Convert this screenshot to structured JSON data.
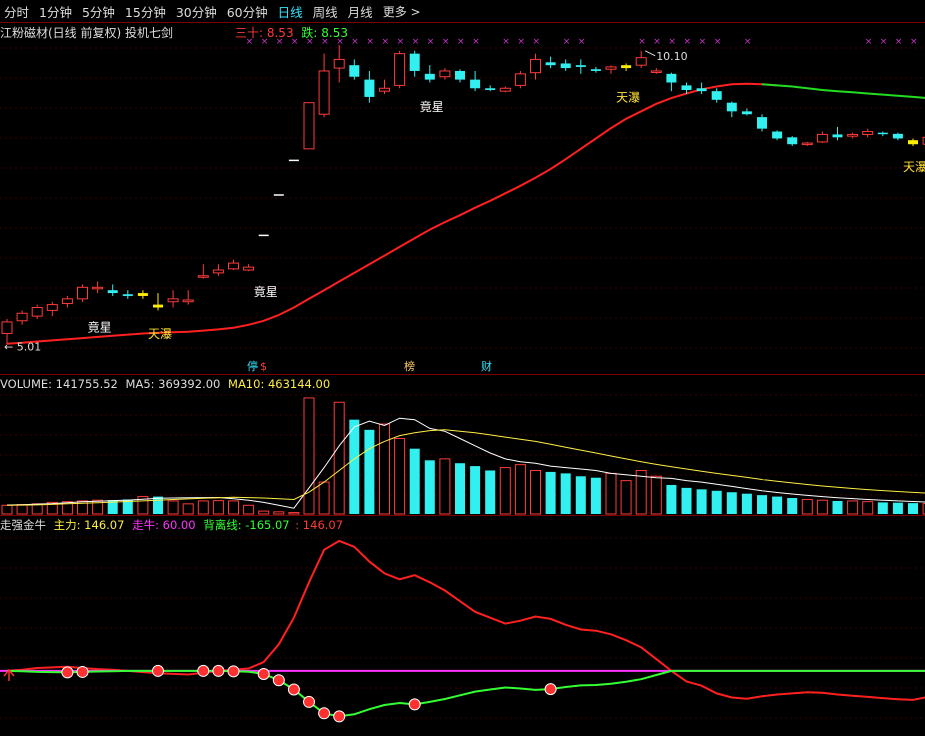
{
  "toolbar": {
    "tabs": [
      {
        "label": "分时",
        "active": false
      },
      {
        "label": "1分钟",
        "active": false
      },
      {
        "label": "5分钟",
        "active": false
      },
      {
        "label": "15分钟",
        "active": false
      },
      {
        "label": "30分钟",
        "active": false
      },
      {
        "label": "60分钟",
        "active": false
      },
      {
        "label": "日线",
        "active": true
      },
      {
        "label": "周线",
        "active": false
      },
      {
        "label": "月线",
        "active": false
      }
    ],
    "more_label": "更多 >"
  },
  "chart_header": {
    "title": "江粉磁材(日线 前复权) 投机七剑",
    "legend_sanshi_label": "三十: 8.53",
    "legend_die_label": "跌: 8.53",
    "legend_sanshi_color": "#ff3b3b",
    "legend_die_color": "#33ff33"
  },
  "price_panel": {
    "high_label": "10.10",
    "low_label": "5.01",
    "annotations": [
      {
        "text": "竟星",
        "color": "#ffffff"
      },
      {
        "text": "天瀑",
        "color": "#ffe033"
      },
      {
        "text": "竟星",
        "color": "#ffffff"
      },
      {
        "text": "竟星",
        "color": "#ffffff"
      },
      {
        "text": "天瀑",
        "color": "#ffe033"
      },
      {
        "text": "天瀑",
        "color": "#ffe033"
      }
    ],
    "event_markers": [
      {
        "text": "停",
        "color": "#33e6ff"
      },
      {
        "text": "$",
        "color": "#ff3b3b"
      },
      {
        "text": "榜",
        "color": "#ffcc66"
      },
      {
        "text": "财",
        "color": "#33e6ff"
      }
    ],
    "candle_up_color": "#ff3b3b",
    "candle_down_color": "#33f0f0",
    "signal_color": "#ffee00",
    "ma_color_up": "#ff2020",
    "ma_color_down": "#22dd22"
  },
  "volume_panel": {
    "volume_label": "VOLUME: 141755.52",
    "ma5_label": "MA5: 369392.00",
    "ma10_label": "MA10: 463144.00",
    "ma5_color": "#ffffff",
    "ma10_color": "#ffee44"
  },
  "indicator_panel": {
    "name_label": "走强金牛",
    "zhuli_label": "主力: 146.07",
    "zouniu_label": "走牛: 60.00",
    "beili_label": "背离线: -165.07",
    "extra_label": ": 146.07",
    "zhuli_color": "#ffee44",
    "zouniu_color": "#ff33ff",
    "beili_color": "#33ff33",
    "extra_color": "#ff3b3b"
  },
  "chart_data": {
    "type": "candlestick",
    "candles": [
      [
        5.2,
        5.45,
        5.01,
        5.4
      ],
      [
        5.42,
        5.6,
        5.35,
        5.55
      ],
      [
        5.5,
        5.7,
        5.45,
        5.65
      ],
      [
        5.6,
        5.75,
        5.5,
        5.7
      ],
      [
        5.72,
        5.85,
        5.65,
        5.8
      ],
      [
        5.8,
        6.05,
        5.75,
        6.0
      ],
      [
        6.0,
        6.1,
        5.9,
        6.0
      ],
      [
        5.95,
        6.05,
        5.85,
        5.9
      ],
      [
        5.88,
        5.95,
        5.8,
        5.85
      ],
      [
        5.85,
        5.95,
        5.8,
        5.9
      ],
      [
        5.7,
        5.9,
        5.6,
        5.65
      ],
      [
        5.75,
        5.95,
        5.65,
        5.8
      ],
      [
        5.75,
        5.95,
        5.7,
        5.78
      ],
      [
        6.2,
        6.4,
        6.15,
        6.2
      ],
      [
        6.25,
        6.4,
        6.2,
        6.3
      ],
      [
        6.32,
        6.48,
        6.3,
        6.42
      ],
      [
        6.3,
        6.4,
        6.28,
        6.35
      ],
      [
        6.9,
        6.9,
        6.9,
        6.9
      ],
      [
        7.6,
        7.6,
        7.6,
        7.6
      ],
      [
        8.2,
        8.2,
        8.2,
        8.2
      ],
      [
        8.4,
        9.2,
        8.4,
        9.2
      ],
      [
        9.0,
        10.05,
        8.95,
        9.75
      ],
      [
        9.8,
        10.2,
        9.55,
        9.95
      ],
      [
        9.85,
        9.95,
        9.6,
        9.65
      ],
      [
        9.6,
        9.75,
        9.2,
        9.3
      ],
      [
        9.4,
        9.6,
        9.35,
        9.45
      ],
      [
        9.5,
        10.1,
        9.45,
        10.05
      ],
      [
        10.05,
        10.1,
        9.65,
        9.75
      ],
      [
        9.7,
        9.85,
        9.55,
        9.6
      ],
      [
        9.65,
        9.8,
        9.6,
        9.75
      ],
      [
        9.75,
        9.78,
        9.55,
        9.6
      ],
      [
        9.6,
        9.75,
        9.4,
        9.45
      ],
      [
        9.45,
        9.5,
        9.4,
        9.42
      ],
      [
        9.4,
        9.48,
        9.38,
        9.45
      ],
      [
        9.5,
        9.75,
        9.45,
        9.7
      ],
      [
        9.72,
        10.05,
        9.6,
        9.95
      ],
      [
        9.9,
        10.0,
        9.8,
        9.85
      ],
      [
        9.88,
        9.95,
        9.75,
        9.8
      ],
      [
        9.85,
        9.95,
        9.7,
        9.82
      ],
      [
        9.78,
        9.82,
        9.72,
        9.75
      ],
      [
        9.78,
        9.85,
        9.7,
        9.82
      ],
      [
        9.8,
        9.88,
        9.75,
        9.85
      ],
      [
        9.85,
        10.1,
        9.8,
        9.98
      ],
      [
        9.75,
        9.8,
        9.7,
        9.75
      ],
      [
        9.7,
        9.72,
        9.4,
        9.55
      ],
      [
        9.5,
        9.55,
        9.35,
        9.42
      ],
      [
        9.45,
        9.55,
        9.35,
        9.4
      ],
      [
        9.4,
        9.45,
        9.2,
        9.25
      ],
      [
        9.2,
        9.22,
        8.95,
        9.05
      ],
      [
        9.05,
        9.1,
        8.98,
        9.0
      ],
      [
        8.95,
        9.0,
        8.7,
        8.75
      ],
      [
        8.7,
        8.72,
        8.55,
        8.58
      ],
      [
        8.6,
        8.62,
        8.45,
        8.48
      ],
      [
        8.5,
        8.52,
        8.45,
        8.5
      ],
      [
        8.52,
        8.7,
        8.5,
        8.65
      ],
      [
        8.65,
        8.78,
        8.55,
        8.6
      ],
      [
        8.62,
        8.68,
        8.58,
        8.65
      ],
      [
        8.65,
        8.75,
        8.6,
        8.7
      ],
      [
        8.68,
        8.7,
        8.62,
        8.66
      ],
      [
        8.66,
        8.68,
        8.55,
        8.58
      ],
      [
        8.55,
        8.58,
        8.45,
        8.48
      ],
      [
        8.48,
        8.7,
        8.45,
        8.6
      ]
    ],
    "ma": [
      5.02,
      5.04,
      5.06,
      5.08,
      5.1,
      5.12,
      5.14,
      5.16,
      5.18,
      5.2,
      5.21,
      5.22,
      5.23,
      5.25,
      5.27,
      5.3,
      5.35,
      5.42,
      5.52,
      5.65,
      5.8,
      5.95,
      6.1,
      6.25,
      6.4,
      6.55,
      6.7,
      6.85,
      7.0,
      7.13,
      7.25,
      7.38,
      7.5,
      7.63,
      7.76,
      7.9,
      8.05,
      8.22,
      8.4,
      8.58,
      8.76,
      8.92,
      9.05,
      9.18,
      9.28,
      9.36,
      9.43,
      9.48,
      9.52,
      9.53,
      9.52,
      9.5,
      9.48,
      9.45,
      9.42,
      9.4,
      9.38,
      9.36,
      9.34,
      9.32,
      9.3,
      9.28
    ],
    "volume": [
      60,
      65,
      70,
      80,
      85,
      90,
      95,
      95,
      100,
      120,
      120,
      90,
      70,
      90,
      92,
      90,
      60,
      20,
      15,
      10,
      800,
      220,
      770,
      650,
      580,
      620,
      520,
      450,
      370,
      380,
      350,
      330,
      300,
      320,
      340,
      300,
      290,
      280,
      260,
      250,
      280,
      230,
      300,
      260,
      200,
      180,
      170,
      160,
      150,
      140,
      130,
      120,
      110,
      100,
      95,
      90,
      90,
      85,
      80,
      78,
      75,
      72
    ],
    "vol_ma5": [
      62,
      64,
      68,
      72,
      78,
      84,
      88,
      92,
      96,
      102,
      108,
      110,
      112,
      113,
      114,
      105,
      95,
      80,
      60,
      40,
      180,
      320,
      470,
      600,
      640,
      610,
      660,
      650,
      590,
      570,
      520,
      470,
      420,
      380,
      360,
      350,
      330,
      320,
      310,
      300,
      280,
      270,
      260,
      250,
      245,
      230,
      220,
      205,
      190,
      175,
      160,
      148,
      138,
      128,
      120,
      112,
      106,
      100,
      95,
      90,
      86,
      82
    ],
    "vol_ma10": [
      60,
      61,
      63,
      66,
      70,
      74,
      78,
      82,
      86,
      90,
      95,
      100,
      104,
      108,
      112,
      115,
      113,
      110,
      105,
      100,
      150,
      220,
      300,
      380,
      450,
      500,
      540,
      560,
      575,
      580,
      570,
      560,
      545,
      530,
      515,
      500,
      480,
      460,
      440,
      420,
      400,
      380,
      360,
      342,
      325,
      310,
      295,
      280,
      266,
      252,
      238,
      226,
      214,
      203,
      193,
      184,
      176,
      168,
      161,
      155,
      149,
      144
    ],
    "zhuli": [
      60,
      62,
      65,
      66,
      67,
      65,
      63,
      62,
      60,
      58,
      56,
      55,
      54,
      57,
      60,
      62,
      64,
      75,
      105,
      150,
      210,
      265,
      280,
      270,
      245,
      225,
      215,
      222,
      210,
      196,
      178,
      160,
      150,
      140,
      145,
      152,
      148,
      138,
      130,
      128,
      122,
      112,
      100,
      80,
      60,
      42,
      35,
      22,
      15,
      13,
      17,
      20,
      22,
      24,
      23,
      20,
      18,
      16,
      14,
      12,
      11,
      16
    ]
  }
}
